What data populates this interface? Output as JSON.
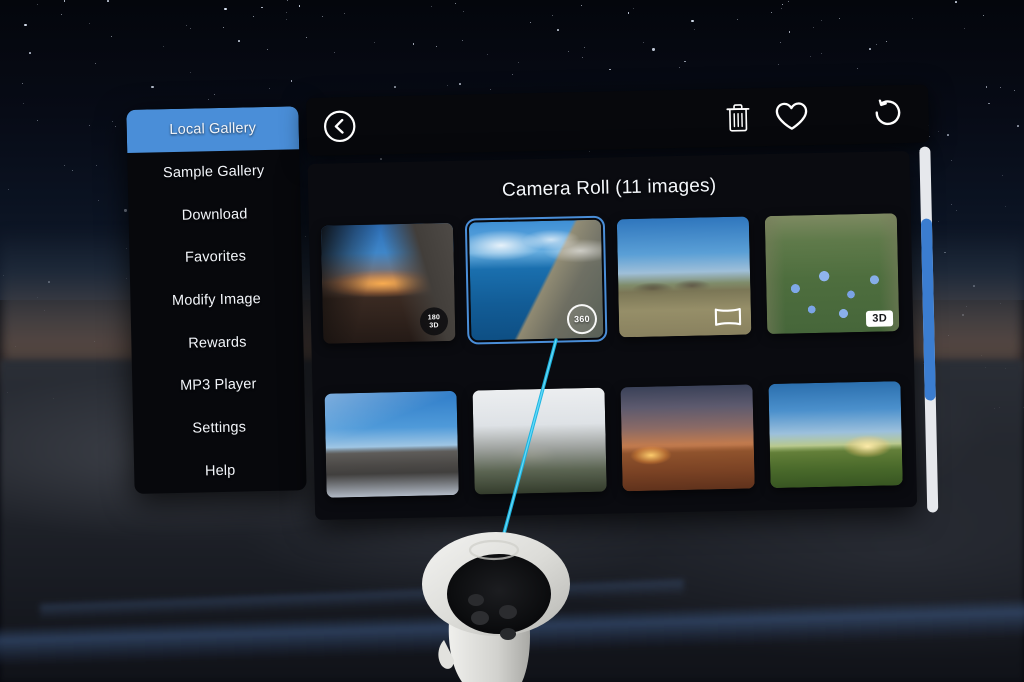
{
  "app": {
    "environment": "vr-space-skybox",
    "accent_color": "#4a8ed8",
    "panel_bg": "#07080c",
    "laser_color": "#1ab4e0"
  },
  "sidebar": {
    "items": [
      {
        "label": "Local Gallery",
        "active": true,
        "name": "local-gallery"
      },
      {
        "label": "Sample Gallery",
        "active": false,
        "name": "sample-gallery"
      },
      {
        "label": "Download",
        "active": false,
        "name": "download"
      },
      {
        "label": "Favorites",
        "active": false,
        "name": "favorites"
      },
      {
        "label": "Modify Image",
        "active": false,
        "name": "modify-image"
      },
      {
        "label": "Rewards",
        "active": false,
        "name": "rewards"
      },
      {
        "label": "MP3 Player",
        "active": false,
        "name": "mp3-player"
      },
      {
        "label": "Settings",
        "active": false,
        "name": "settings"
      },
      {
        "label": "Help",
        "active": false,
        "name": "help"
      }
    ]
  },
  "toolbar": {
    "back_label": "Back",
    "delete_label": "Delete",
    "favorite_label": "Favorite",
    "refresh_label": "Refresh"
  },
  "gallery": {
    "title": "Camera Roll (11 images)",
    "image_count": 11,
    "collection_name": "Camera Roll",
    "rows": [
      {
        "thumbnails": [
          {
            "name": "thumb-castle-sunset",
            "art": "art-castle",
            "badge": {
              "type": "circle",
              "line1": "180",
              "line2": "3D"
            },
            "selected": false
          },
          {
            "name": "thumb-coastline",
            "art": "art-coast",
            "badge": {
              "type": "ring",
              "text": "360"
            },
            "selected": true
          },
          {
            "name": "thumb-alpine-village",
            "art": "art-village",
            "badge": {
              "type": "pano",
              "text": ""
            },
            "selected": false
          },
          {
            "name": "thumb-blue-flowers",
            "art": "art-flowers",
            "badge": {
              "type": "tag",
              "text": "3D"
            },
            "selected": false
          }
        ]
      },
      {
        "thumbnails": [
          {
            "name": "thumb-snowy-peak",
            "art": "art-alps",
            "badge": {
              "type": "none"
            },
            "selected": false
          },
          {
            "name": "thumb-foggy-cliff",
            "art": "art-fog",
            "badge": {
              "type": "none"
            },
            "selected": false
          },
          {
            "name": "thumb-desert-sunset",
            "art": "art-desert",
            "badge": {
              "type": "none"
            },
            "selected": false
          },
          {
            "name": "thumb-field-sunset",
            "art": "art-field",
            "badge": {
              "type": "none"
            },
            "selected": false
          }
        ]
      }
    ]
  },
  "scrollbar": {
    "track_color": "#e6e8ec",
    "thumb_color": "#3b7dd0",
    "position_label": "scroll-middle"
  },
  "controller": {
    "label": "VR hand controller",
    "pointer_label": "laser pointer"
  }
}
